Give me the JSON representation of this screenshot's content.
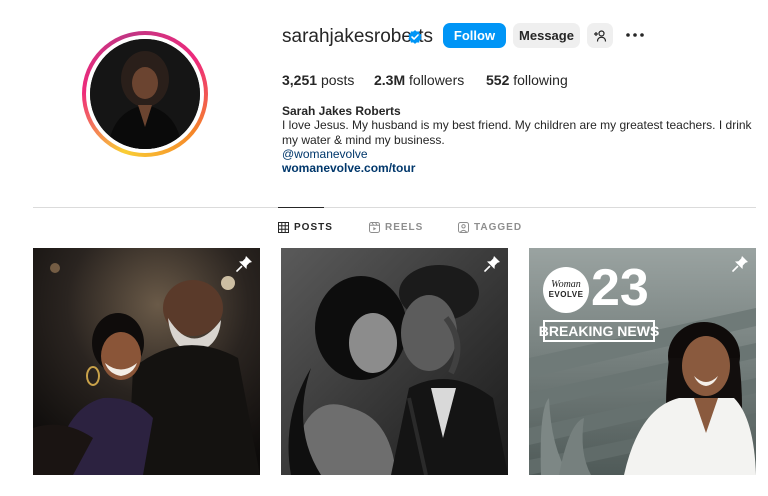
{
  "profile": {
    "username": "sarahjakesroberts",
    "verified_icon": "verified-badge-icon",
    "follow_label": "Follow",
    "message_label": "Message",
    "add_user_icon": "person-add-icon",
    "more_icon": "more-options-icon"
  },
  "stats": {
    "posts_count": "3,251",
    "posts_label": "posts",
    "followers_count": "2.3M",
    "followers_label": "followers",
    "following_count": "552",
    "following_label": "following"
  },
  "bio": {
    "full_name": "Sarah Jakes Roberts",
    "text": "I love Jesus. My husband is my best friend. My children are my greatest teachers. I drink my water & mind my business.",
    "handle": "@womanevolve",
    "link": "womanevolve.com/tour"
  },
  "tabs": [
    {
      "label": "POSTS",
      "icon": "grid-icon",
      "active": true
    },
    {
      "label": "REELS",
      "icon": "reels-icon",
      "active": false
    },
    {
      "label": "TAGGED",
      "icon": "tagged-icon",
      "active": false
    }
  ],
  "posts": [
    {
      "pinned": true,
      "pin_icon": "pin-icon"
    },
    {
      "pinned": true,
      "pin_icon": "pin-icon"
    },
    {
      "pinned": true,
      "pin_icon": "pin-icon",
      "overlay_logo_line1": "Woman",
      "overlay_logo_line2": "EVOLVE",
      "overlay_number": "23",
      "overlay_banner": "BREAKING NEWS"
    }
  ],
  "colors": {
    "accent": "#0095f6",
    "link": "#00376b",
    "muted": "#8e8e8e"
  }
}
